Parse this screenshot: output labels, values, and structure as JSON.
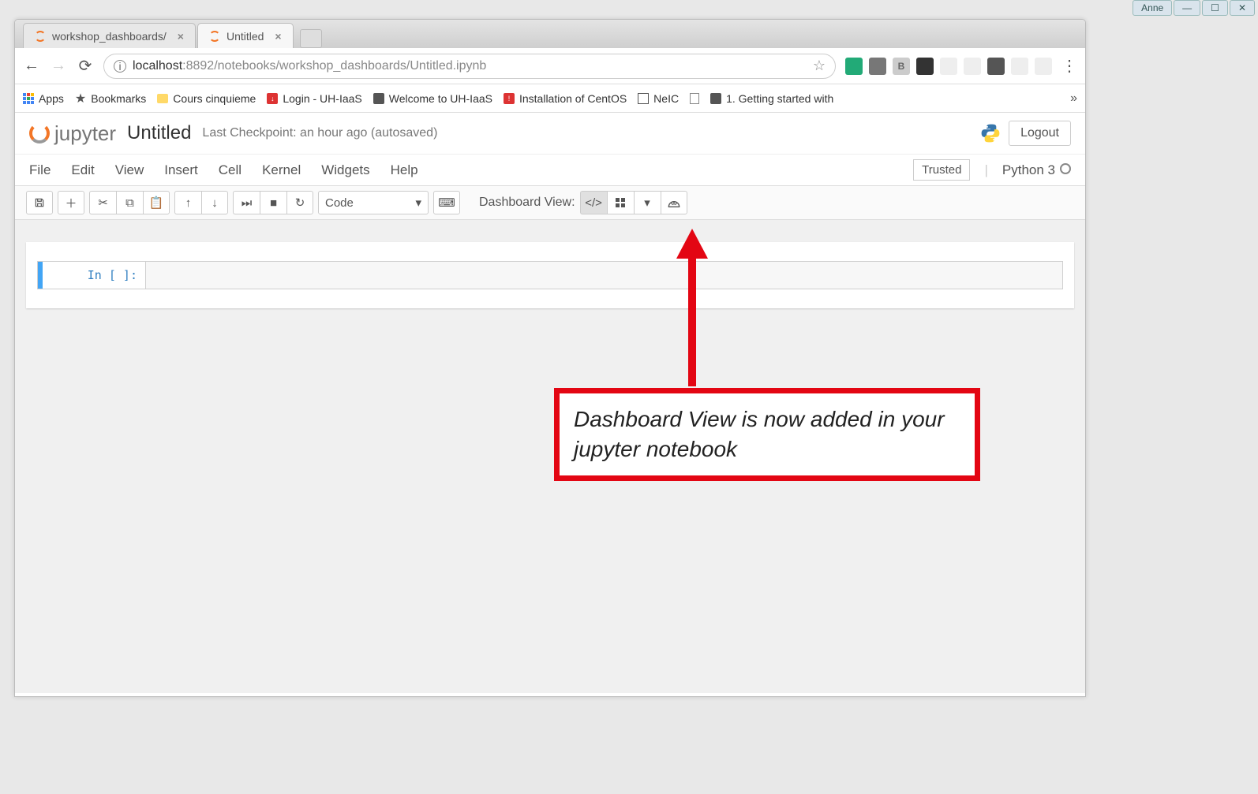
{
  "window": {
    "user_label": "Anne"
  },
  "browser": {
    "tabs": [
      {
        "title": "workshop_dashboards/"
      },
      {
        "title": "Untitled"
      }
    ],
    "address": {
      "host": "localhost",
      "port_path": ":8892/notebooks/workshop_dashboards/Untitled.ipynb"
    },
    "bookmarks": {
      "apps": "Apps",
      "bookmarks": "Bookmarks",
      "items": [
        "Cours cinquieme",
        "Login - UH-IaaS",
        "Welcome to UH-IaaS",
        "Installation of CentOS",
        "NeIC",
        "1. Getting started with"
      ]
    }
  },
  "jupyter": {
    "brand": "jupyter",
    "title": "Untitled",
    "checkpoint": "Last Checkpoint: an hour ago (autosaved)",
    "logout": "Logout",
    "menu": [
      "File",
      "Edit",
      "View",
      "Insert",
      "Cell",
      "Kernel",
      "Widgets",
      "Help"
    ],
    "trusted": "Trusted",
    "kernel": "Python 3",
    "celltype": "Code",
    "dashboard_label": "Dashboard View:",
    "cell_prompt": "In [ ]:"
  },
  "annotation": {
    "text": "Dashboard View is now added in your jupyter notebook"
  }
}
